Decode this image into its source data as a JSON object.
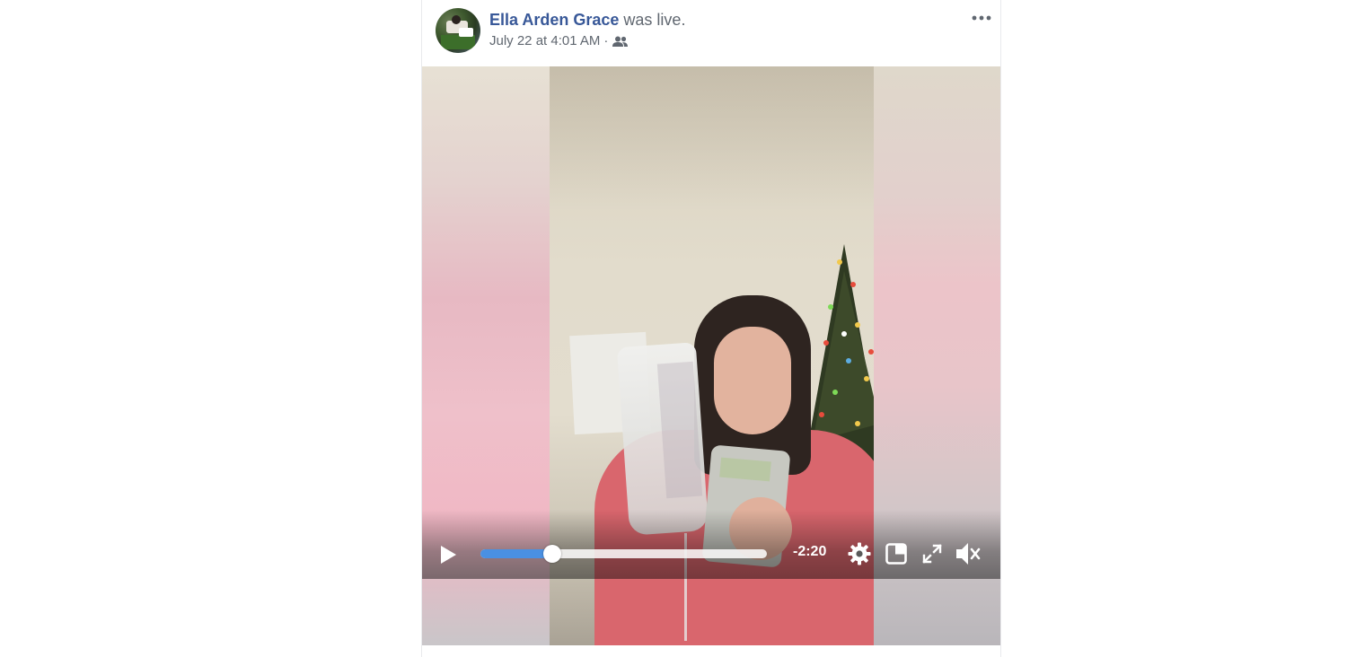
{
  "post": {
    "author_name": "Ella Arden Grace",
    "action_text": "was live.",
    "timestamp": "July 22 at 4:01 AM",
    "separator": "·",
    "audience_icon": "friends-icon",
    "more_icon": "more-options-icon"
  },
  "video": {
    "time_remaining": "-2:20",
    "progress_fraction": 0.25,
    "icons": {
      "play": "play-icon",
      "settings": "gear-icon",
      "pip": "picture-in-picture-icon",
      "fullscreen": "fullscreen-icon",
      "mute": "muted-speaker-icon"
    }
  },
  "colors": {
    "author_link": "#385898",
    "progress_fill": "#4a90e2"
  }
}
